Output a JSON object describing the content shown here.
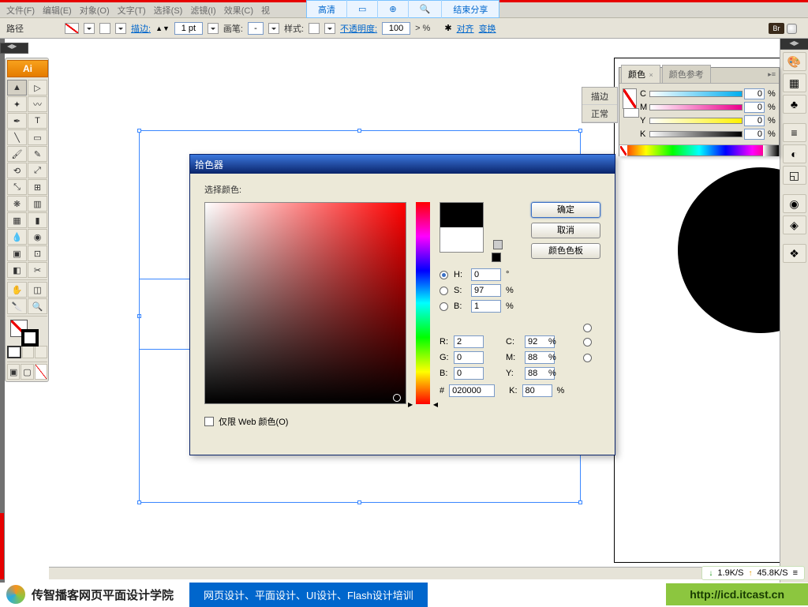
{
  "menubar": [
    "文件(F)",
    "编辑(E)",
    "对象(O)",
    "文字(T)",
    "选择(S)",
    "滤镜(I)",
    "效果(C)",
    "视"
  ],
  "share": {
    "hd": "高清",
    "box": "",
    "target": "",
    "end": "结束分享"
  },
  "optbar": {
    "path": "路径",
    "stroke": "描边:",
    "weight": "1 pt",
    "brush": "画笔:",
    "style": "样式:",
    "opacity": "不透明度:",
    "opacity_val": "100",
    "opacity_pct": "> %",
    "align": "对齐",
    "transform": "变换",
    "br": "Br"
  },
  "toolbox": {
    "logo": "Ai"
  },
  "mini_panel": {
    "stroke": "描边",
    "normal": "正常"
  },
  "color_panel": {
    "tab1": "颜色",
    "tab2": "颜色参考",
    "c": {
      "l": "C",
      "v": "0",
      "p": "%"
    },
    "m": {
      "l": "M",
      "v": "0",
      "p": "%"
    },
    "y": {
      "l": "Y",
      "v": "0",
      "p": "%"
    },
    "k": {
      "l": "K",
      "v": "0",
      "p": "%"
    }
  },
  "dialog": {
    "title": "拾色器",
    "select": "选择颜色:",
    "ok": "确定",
    "cancel": "取消",
    "swatches": "颜色色板",
    "H": {
      "l": "H:",
      "v": "0",
      "u": "°"
    },
    "S": {
      "l": "S:",
      "v": "97",
      "u": "%"
    },
    "B": {
      "l": "B:",
      "v": "1",
      "u": "%"
    },
    "R": {
      "l": "R:",
      "v": "2"
    },
    "G": {
      "l": "G:",
      "v": "0"
    },
    "Bb": {
      "l": "B:",
      "v": "0"
    },
    "C": {
      "l": "C:",
      "v": "92",
      "u": "%"
    },
    "M": {
      "l": "M:",
      "v": "88",
      "u": "%"
    },
    "Y": {
      "l": "Y:",
      "v": "88",
      "u": "%"
    },
    "K": {
      "l": "K:",
      "v": "80",
      "u": "%"
    },
    "hex": {
      "l": "#",
      "v": "020000"
    },
    "webonly": "仅限 Web 颜色(O)"
  },
  "netstat": {
    "down": "1.9K/S",
    "up": "45.8K/S"
  },
  "footer": {
    "name": "传智播客网页平面设计学院",
    "mid": "网页设计、平面设计、UI设计、Flash设计培训",
    "url": "http://icd.itcast.cn"
  }
}
